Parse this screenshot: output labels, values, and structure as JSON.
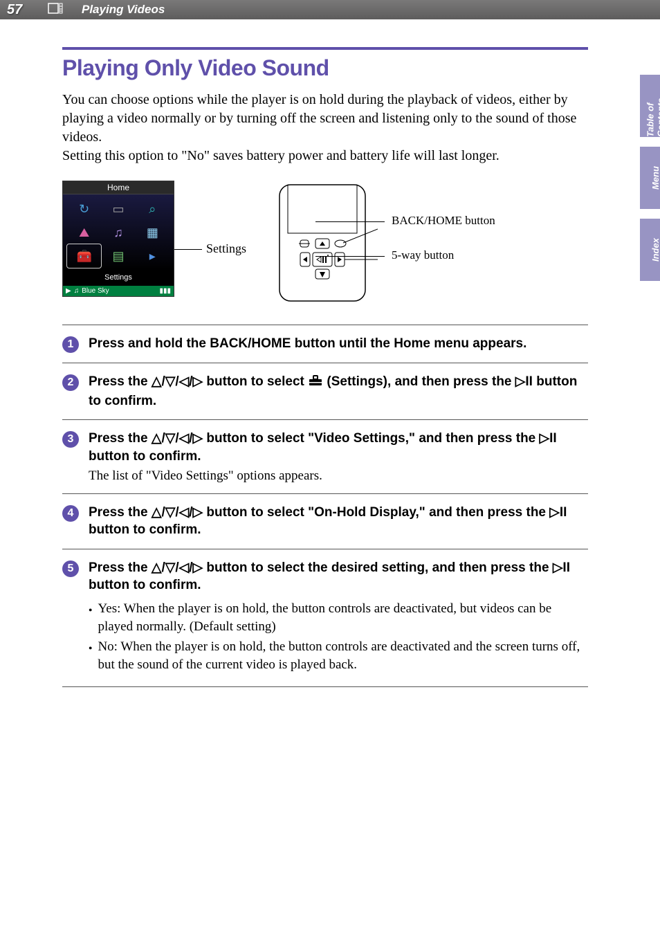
{
  "page_number": "57",
  "breadcrumb": "Playing Videos",
  "side_tabs": [
    "Table of\nContents",
    "Menu",
    "Index"
  ],
  "title": "Playing Only Video Sound",
  "intro_p1": "You can choose options while the player is on hold during the playback of videos, either by playing a video normally or by turning off the screen and listening only to the sound of those videos.",
  "intro_p2": "Setting this option to \"No\" saves battery power and battery life will last longer.",
  "device": {
    "home_label": "Home",
    "settings_label": "Settings",
    "now_playing": "Blue Sky",
    "settings_callout": "Settings"
  },
  "diagram": {
    "back_home": "BACK/HOME button",
    "fiveway": "5-way button"
  },
  "steps": [
    {
      "lead": "Press and hold the BACK/HOME button until the Home menu appears."
    },
    {
      "lead_pre": "Press the ",
      "lead_mid": " button to select ",
      "lead_post": " (Settings), and then press the ",
      "lead_end": " button to confirm."
    },
    {
      "lead_pre": "Press the ",
      "lead_mid": " button to select \"Video Settings,\" and then press the ",
      "lead_end": " button to confirm.",
      "follow": "The list of \"Video Settings\" options appears."
    },
    {
      "lead_pre": "Press the ",
      "lead_mid": " button to select \"On-Hold Display,\" and then press the ",
      "lead_end": " button to confirm."
    },
    {
      "lead_pre": "Press the ",
      "lead_mid": " button to select the desired setting, and then press the ",
      "lead_end": " button to confirm.",
      "bullets": [
        "Yes: When the player is on hold, the button controls are deactivated, but videos can be played normally. (Default setting)",
        "No: When the player is on hold, the button controls are deactivated and the screen turns off, but the sound of the current video is played back."
      ]
    }
  ]
}
